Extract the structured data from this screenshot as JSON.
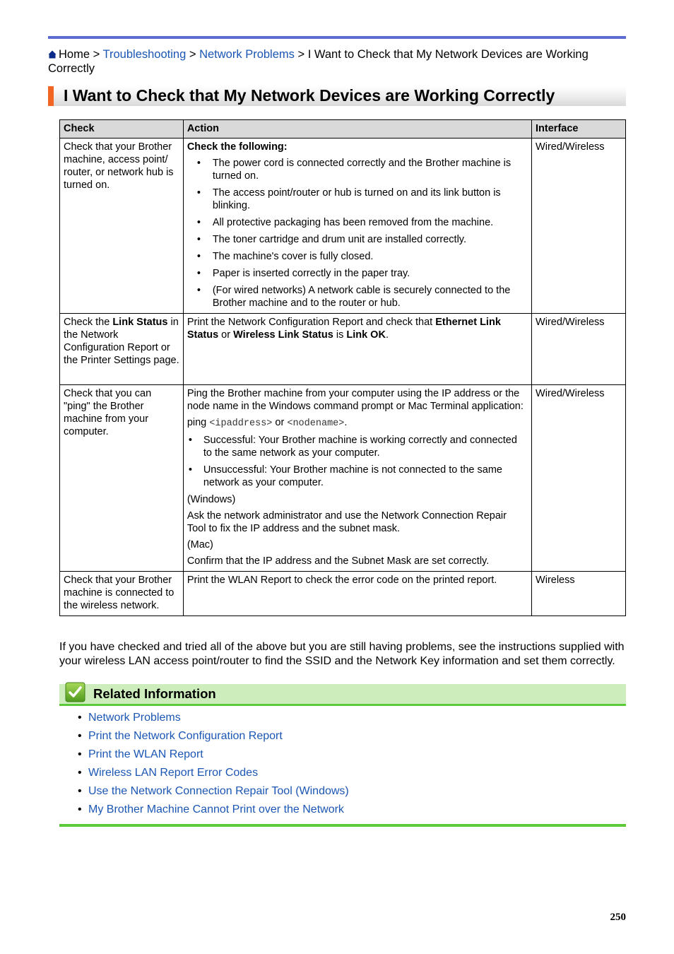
{
  "breadcrumb": {
    "home": "Home",
    "separator": ">",
    "links": [
      "Troubleshooting",
      "Network Problems"
    ],
    "current": "I Want to Check that My Network Devices are Working Correctly"
  },
  "page_title": "I Want to Check that My Network Devices are Working Correctly",
  "table": {
    "headers": [
      "Check",
      "Action",
      "Interface"
    ],
    "rows": [
      {
        "check": "Check that your Brother machine, access point/ router, or network hub is turned on.",
        "action_heading": "Check the following:",
        "action_items": [
          "The power cord is connected correctly and the Brother machine is turned on.",
          "The access point/router or hub is turned on and its link button is blinking.",
          "All protective packaging has been removed from the machine.",
          "The toner cartridge and drum unit are installed correctly.",
          "The machine's cover is fully closed.",
          "Paper is inserted correctly in the paper tray.",
          "(For wired networks) A network cable is securely connected to the Brother machine and to the router or hub."
        ],
        "interface": "Wired/Wireless"
      },
      {
        "check_prefix": "Check the ",
        "check_bold": "Link Status",
        "check_suffix": " in the Network Configuration Report or the Printer Settings page.",
        "action_parts": {
          "t1": "Print the Network Configuration Report and check that ",
          "b1": "Ethernet Link Status",
          "t2": " or ",
          "b2": "Wireless Link Status",
          "t3": " is ",
          "b3": "Link OK",
          "t4": "."
        },
        "interface": "Wired/Wireless"
      },
      {
        "check": "Check that you can \"ping\" the Brother machine from your computer.",
        "action_intro": "Ping the Brother machine from your computer using the IP address or the node name in the Windows command prompt or Mac Terminal application:",
        "ping_prefix": "ping ",
        "ping_arg1": "<ipaddress>",
        "ping_or": " or ",
        "ping_arg2": "<nodename>",
        "ping_end": ".",
        "action_items": [
          "Successful: Your Brother machine is working correctly and connected to the same network as your computer.",
          "Unsuccessful: Your Brother machine is not connected to the same network as your computer."
        ],
        "windows_label": "(Windows)",
        "windows_text": "Ask the network administrator and use the Network Connection Repair Tool to fix the IP address and the subnet mask.",
        "mac_label": "(Mac)",
        "mac_text": "Confirm that the IP address and the Subnet Mask are set correctly.",
        "interface": "Wired/Wireless"
      },
      {
        "check": "Check that your Brother machine is connected to the wireless network.",
        "action": "Print the WLAN Report to check the error code on the printed report.",
        "interface": "Wireless"
      }
    ]
  },
  "footer_text": "If you have checked and tried all of the above but you are still having problems, see the instructions supplied with your wireless LAN access point/router to find the SSID and the Network Key information and set them correctly.",
  "related": {
    "title": "Related Information",
    "links": [
      "Network Problems",
      "Print the Network Configuration Report",
      "Print the WLAN Report",
      "Wireless LAN Report Error Codes",
      "Use the Network Connection Repair Tool (Windows)",
      "My Brother Machine Cannot Print over the Network"
    ]
  },
  "page_number": "250",
  "colors": {
    "top_rule": "#5b6bd1",
    "title_accent": "#f26522",
    "link": "#1b56b4",
    "related_bg": "#cdeebc",
    "related_rule": "#5cc93a"
  }
}
